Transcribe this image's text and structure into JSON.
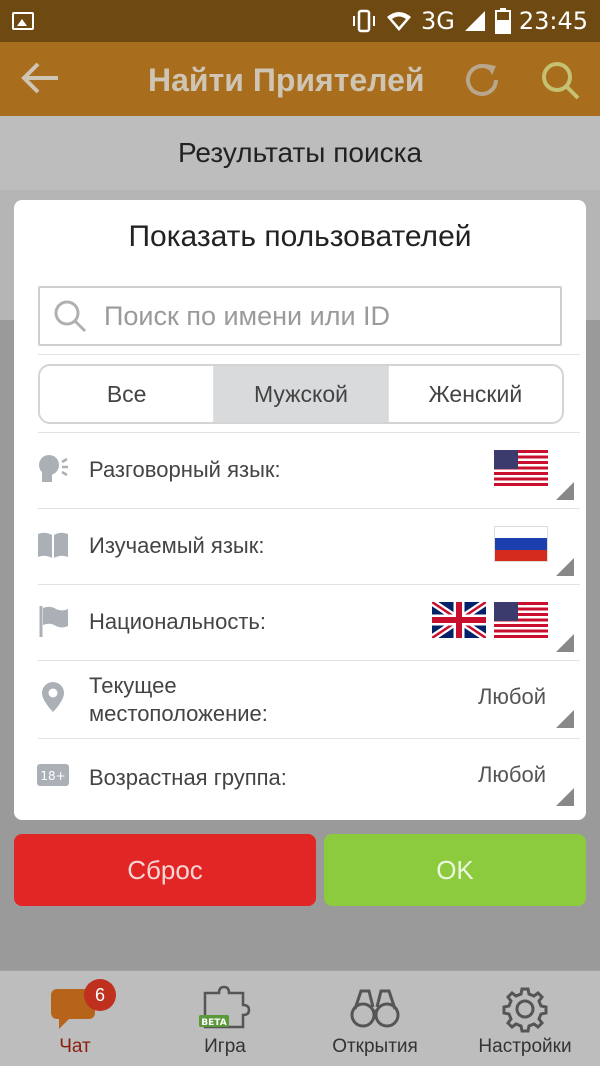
{
  "status_bar": {
    "network": "3G",
    "time": "23:45"
  },
  "header": {
    "title": "Найти Приятелей"
  },
  "subheader": {
    "title": "Результаты поиска"
  },
  "dialog": {
    "title": "Показать пользователей",
    "search_placeholder": "Поиск по имени или ID",
    "gender_tabs": [
      {
        "label": "Все",
        "selected": false
      },
      {
        "label": "Мужской",
        "selected": true
      },
      {
        "label": "Женский",
        "selected": false
      }
    ],
    "filters": [
      {
        "label": "Разговорный язык:",
        "icon": "speaking-icon",
        "flags": [
          "us"
        ]
      },
      {
        "label": "Изучаемый язык:",
        "icon": "book-icon",
        "flags": [
          "ru"
        ]
      },
      {
        "label": "Национальность:",
        "icon": "flag-icon",
        "flags": [
          "uk",
          "us"
        ]
      },
      {
        "label_line1": "Текущее",
        "label_line2": "местоположение:",
        "icon": "location-pin-icon",
        "value": "Любой"
      },
      {
        "label": "Возрастная группа:",
        "icon": "age-18-icon",
        "value": "Любой"
      }
    ]
  },
  "buttons": {
    "reset": "Сброс",
    "ok": "OK"
  },
  "bottom_nav": {
    "items": [
      {
        "label": "Чат",
        "icon": "chat-icon",
        "badge": "6",
        "active": true
      },
      {
        "label": "Игра",
        "icon": "puzzle-icon",
        "tag": "BETA"
      },
      {
        "label": "Открытия",
        "icon": "binoculars-icon"
      },
      {
        "label": "Настройки",
        "icon": "gear-icon"
      }
    ]
  },
  "colors": {
    "header": "#a86d1d",
    "status_bar": "#6e4a12",
    "reset": "#e22525",
    "ok": "#8ccb3d",
    "badge": "#c0301e"
  }
}
